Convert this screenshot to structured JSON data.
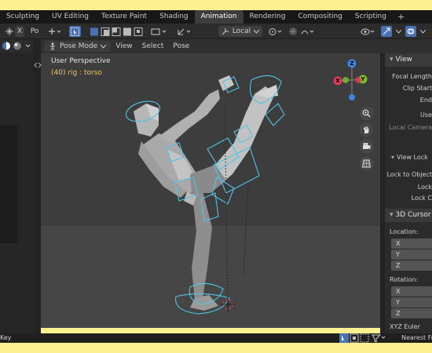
{
  "tabs": [
    {
      "label": "Sculpting",
      "active": false
    },
    {
      "label": "UV Editing",
      "active": false
    },
    {
      "label": "Texture Paint",
      "active": false
    },
    {
      "label": "Shading",
      "active": false
    },
    {
      "label": "Animation",
      "active": true
    },
    {
      "label": "Rendering",
      "active": false
    },
    {
      "label": "Compositing",
      "active": false
    },
    {
      "label": "Scripting",
      "active": false
    }
  ],
  "tab_add": "+",
  "toolbar": {
    "left_label": "Po",
    "left_x": "X",
    "transform_orientation": "Local"
  },
  "viewport": {
    "mode": "Pose Mode",
    "menus": [
      "View",
      "Select",
      "Pose"
    ],
    "perspective": "User Perspective",
    "active_object": "(40) rig : torso",
    "gizmo": {
      "z": "Z",
      "y": "Y",
      "x": "X"
    }
  },
  "properties": {
    "view_section": "View",
    "focal_length": "Focal Length",
    "clip_start": "Clip Start",
    "clip_end": "End",
    "use": "Use",
    "local_camera": "Local Camera",
    "view_lock": "View Lock",
    "lock_to_object": "Lock to Object",
    "lock": "Lock",
    "lock_c": "Lock C",
    "cursor_section": "3D Cursor",
    "location": "Location:",
    "loc_x": "X",
    "loc_y": "Y",
    "loc_z": "Z",
    "rotation": "Rotation:",
    "rot_x": "X",
    "rot_y": "Y",
    "rot_z": "Z",
    "euler": "XYZ Euler"
  },
  "status": {
    "left": "Key",
    "right": "Nearest Fr"
  },
  "colors": {
    "accent_blue": "#4772b3",
    "active_text": "#e8c86a",
    "axis_x": "#e23b55",
    "axis_y": "#7bbf2c",
    "axis_z": "#3c85e0",
    "bone_outline": "#4fc4e8",
    "background_frame": "#fbf190"
  }
}
